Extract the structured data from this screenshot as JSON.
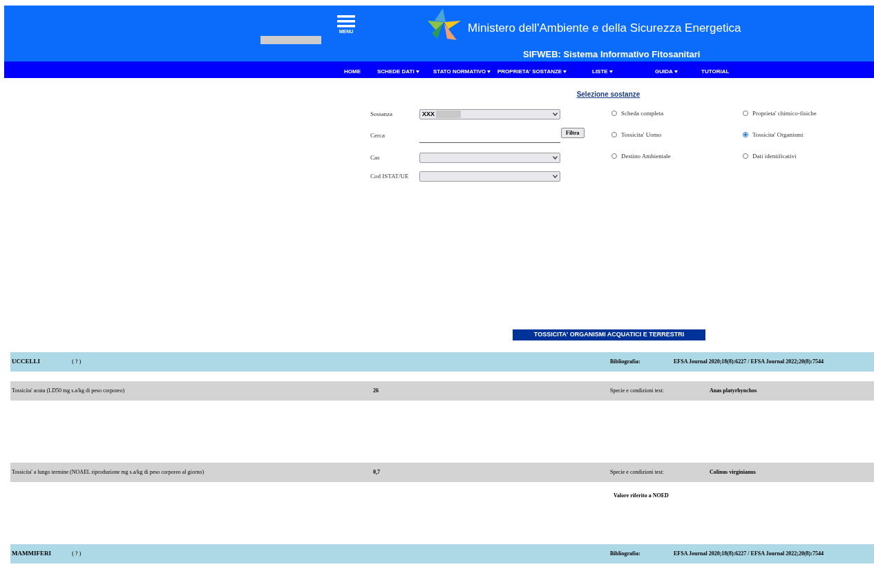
{
  "header": {
    "menu_label": "MENU",
    "title": "Ministero dell'Ambiente e della Sicurezza Energetica",
    "subtitle": "SIFWEB: Sistema Informativo Fitosanitari"
  },
  "nav": [
    {
      "label": "HOME",
      "dropdown": false
    },
    {
      "label": "SCHEDE DATI",
      "dropdown": true
    },
    {
      "label": "STATO NORMATIVO",
      "dropdown": true
    },
    {
      "label": "PROPRIETA' SOSTANZE",
      "dropdown": true
    },
    {
      "label": "LISTE",
      "dropdown": true
    },
    {
      "label": "GUIDA",
      "dropdown": true
    },
    {
      "label": "TUTORIAL",
      "dropdown": false
    }
  ],
  "form": {
    "title": "Selezione sostanze",
    "fields": [
      {
        "kind": "select",
        "label": "Sostanza",
        "value": "XXX"
      },
      {
        "kind": "text",
        "label": "Cerca",
        "button": "Filtra"
      },
      {
        "kind": "select",
        "label": "Cas"
      },
      {
        "kind": "select",
        "label": "Cod ISTAT/UE"
      }
    ],
    "options": [
      {
        "label": "Scheda completa",
        "selected": false
      },
      {
        "label": "Proprieta' chimico-fisiche",
        "selected": false
      },
      {
        "label": "Tossicita' Uomo",
        "selected": false
      },
      {
        "label": "Tossicita' Organismi",
        "selected": true
      },
      {
        "label": "Destino Ambientale",
        "selected": false
      },
      {
        "label": "Dati identificativi",
        "selected": false
      }
    ]
  },
  "section_title": "TOSSICITA' ORGANISMI ACQUATICI E TERRESTRI",
  "groups": [
    {
      "name": "UCCELLI",
      "help": "( ? )",
      "bibliography_label": "Bibliografia:",
      "bibliography": "EFSA Journal 2020;18(8):6227 / EFSA Journal 2022;20(8):7544",
      "rows": [
        {
          "label": "Tossicita' acuta (LD50 mg s.a/kg di peso corporeo)",
          "value": "26",
          "species_label": "Specie e condizioni test:",
          "species": "Anas platyrhynchos"
        },
        {
          "label": "Tossicita' a lungo termine (NOAEL riproduzione mg s.a/kg di peso corporeo al giorno)",
          "value": "0,7",
          "species_label": "Specie e condizioni test:",
          "species": "Colinus virginianus",
          "note": "Valore riferito a NOED"
        }
      ]
    },
    {
      "name": "MAMMIFERI",
      "help": "( ? )",
      "bibliography_label": "Bibliografia:",
      "bibliography": "EFSA Journal 2020;18(8):6227 / EFSA Journal 2022;20(8):7544"
    }
  ]
}
